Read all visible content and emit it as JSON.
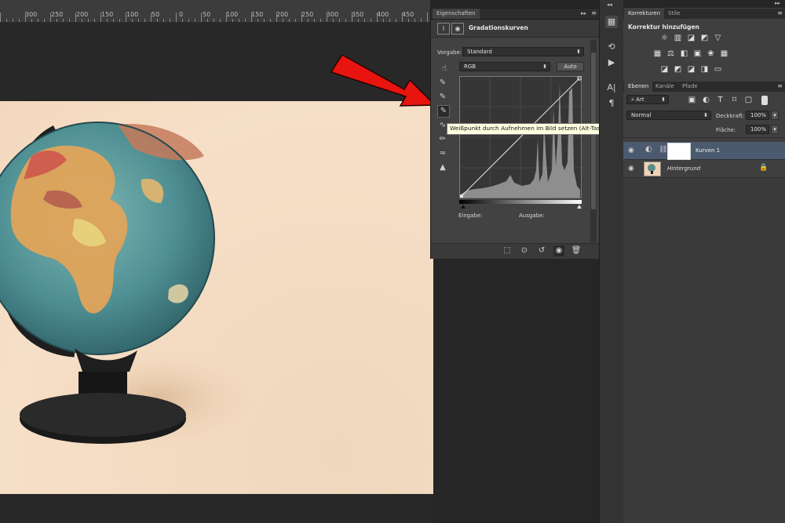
{
  "ruler": {
    "labels": [
      "300",
      "250",
      "200",
      "150",
      "100",
      "50",
      "0",
      "50",
      "100",
      "150",
      "200",
      "250",
      "300",
      "350",
      "400",
      "450"
    ]
  },
  "properties_panel": {
    "tab": "Eigenschaften",
    "title": "Gradationskurven",
    "preset_label": "Vorgabe:",
    "preset_value": "Standard",
    "channel": "RGB",
    "auto_button": "Auto",
    "input_label": "Eingabe:",
    "output_label": "Ausgabe:"
  },
  "tooltip": "Weißpunkt durch Aufnehmen im Bild setzen (Alt-Taste zum Anzeigen der Beschneidungsvorschau)",
  "adjustments_panel": {
    "tabs": [
      "Korrekturen",
      "Stile"
    ],
    "heading": "Korrektur hinzufügen"
  },
  "layers_panel": {
    "tabs": [
      "Ebenen",
      "Kanäle",
      "Pfade"
    ],
    "filter_kind": "Art",
    "blend_mode": "Normal",
    "opacity_label": "Deckkraft:",
    "opacity_value": "100%",
    "fill_label": "Fläche:",
    "fill_value": "100%",
    "layers": [
      {
        "name": "Kurven 1",
        "selected": true
      },
      {
        "name": "Hintergrund",
        "selected": false
      }
    ]
  },
  "colors": {
    "accent_arrow": "#e8140f",
    "selected_layer": "#4b5a6e"
  }
}
